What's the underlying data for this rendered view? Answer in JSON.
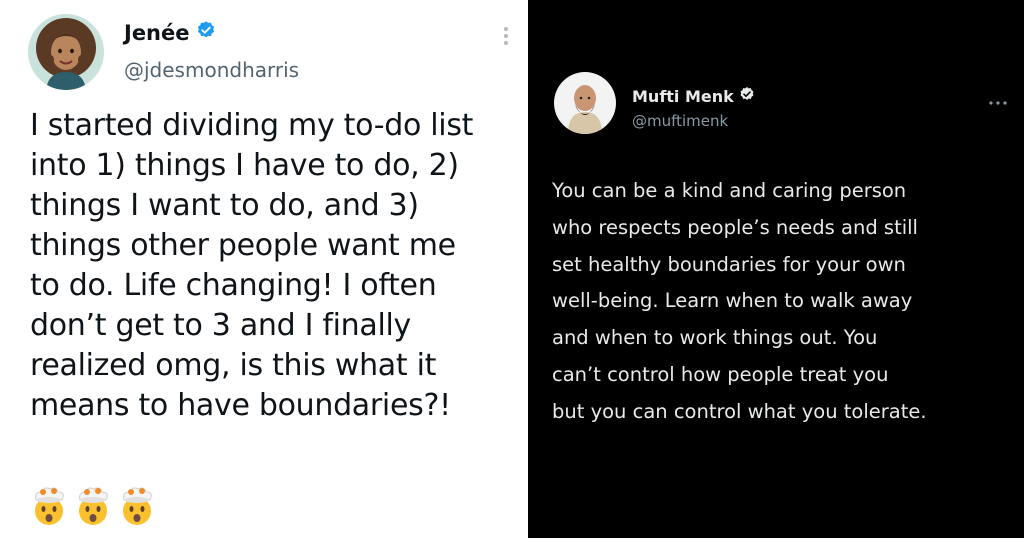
{
  "left_tweet": {
    "author_name": "Jenée",
    "handle": "@jdesmondharris",
    "verified": true,
    "body_lines": [
      "I started dividing my to-do list",
      "into 1) things I have to do, 2)",
      "things I want to do, and 3)",
      "things other people want me",
      "to do. Life changing! I often",
      "don’t get to 3 and I finally",
      "realized omg, is this what it",
      "means to have boundaries?!"
    ],
    "emoji": [
      "exploding-head-emoji",
      "exploding-head-emoji",
      "exploding-head-emoji"
    ]
  },
  "right_tweet": {
    "author_name": "Mufti Menk",
    "handle": "@muftimenk",
    "verified": true,
    "more_label": "···",
    "body_lines": [
      "You can be a kind and caring person",
      "who respects people’s needs and still",
      "set healthy boundaries for your own",
      "well-being. Learn when to walk away",
      "and when to work things out. You",
      "can’t control how people treat you",
      "but you can control what you tolerate."
    ]
  },
  "colors": {
    "left_bg": "#ffffff",
    "right_bg": "#000000",
    "verified_blue": "#1d9bf0",
    "left_handle": "#536471",
    "right_handle": "#8b98a5"
  }
}
